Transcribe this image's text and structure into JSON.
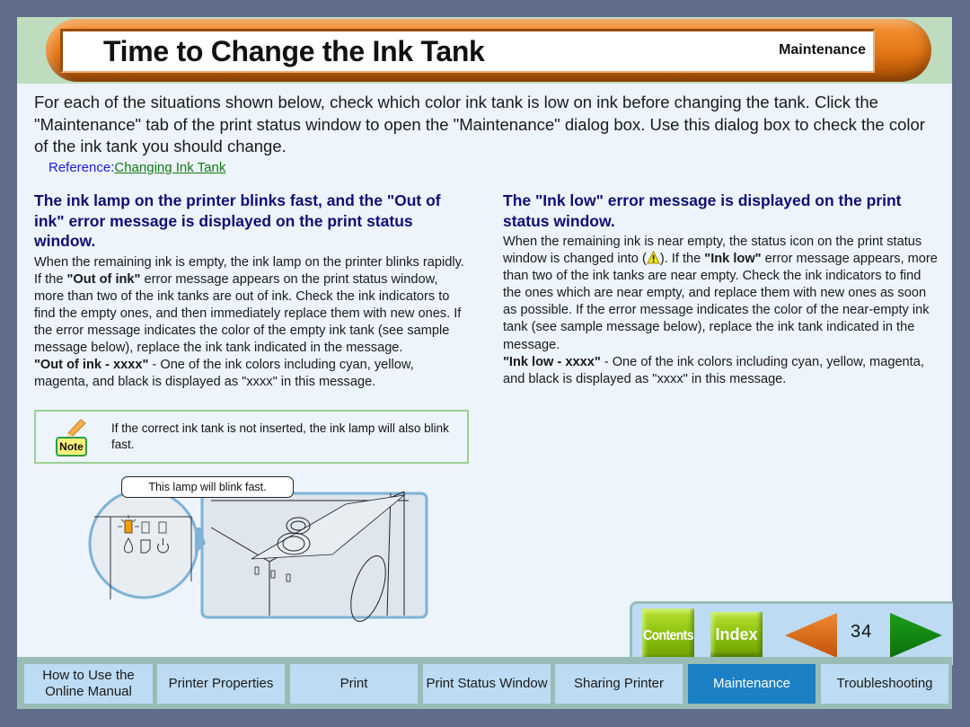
{
  "header": {
    "title": "Time to Change the Ink Tank",
    "section": "Maintenance"
  },
  "intro": {
    "text": "For each of the situations shown below, check which color ink tank is low on ink before changing the tank. Click the \"Maintenance\" tab of the print status window to open the \"Maintenance\" dialog box. Use this dialog box to check the color of the ink tank you should change.",
    "reference_label": "Reference:",
    "reference_link": "Changing Ink Tank"
  },
  "left_section": {
    "heading": "The ink lamp on the printer blinks fast, and the \"Out of ink\" error message is displayed on the print status window.",
    "body_1": "When the remaining ink is empty, the ink lamp on the printer blinks rapidly. If the ",
    "body_bold": "\"Out of ink\"",
    "body_2": " error message appears on the print status window, more than two of the ink tanks are out of ink. Check the ink indicators to find the empty ones, and then immediately replace them with new ones. If the error message indicates the color of the empty ink tank (see sample message below), replace the ink tank indicated in the message.",
    "sample_bold": "\"Out of ink - xxxx\"",
    "sample_text": " - One of the ink colors including cyan, yellow, magenta, and black is displayed as \"xxxx\" in this message."
  },
  "note": {
    "tag": "Note",
    "text": "If the correct ink tank is not inserted, the ink lamp will also blink fast."
  },
  "illustration": {
    "callout": "This lamp will blink fast.",
    "lamp_color": "#f0a000"
  },
  "right_section": {
    "heading": "The \"Ink low\" error message is displayed on the print status window.",
    "body_1": "When the remaining ink is near empty, the status icon on the print status window is changed into (",
    "body_2": "). If the ",
    "body_bold": "\"Ink low\"",
    "body_3": " error message appears, more than two of the ink tanks are near empty. Check the ink indicators to find the ones which are near empty, and replace them with new ones as soon as possible. If the error message indicates the color of the near-empty ink tank (see sample message below), replace the ink tank indicated in the message.",
    "sample_bold": "\"Ink low - xxxx\"",
    "sample_text": " - One of the ink colors including cyan, yellow, magenta, and black is displayed as \"xxxx\" in this message."
  },
  "nav": {
    "contents_label": "Contents",
    "index_label": "Index",
    "page_number": "34",
    "prev_color": "#e06a10",
    "next_color": "#138a13"
  },
  "tabs": [
    {
      "label": "How to Use the Online Manual",
      "active": false
    },
    {
      "label": "Printer Properties",
      "active": false
    },
    {
      "label": "Print",
      "active": false
    },
    {
      "label": "Print Status Window",
      "active": false
    },
    {
      "label": "Sharing Printer",
      "active": false
    },
    {
      "label": "Maintenance",
      "active": true
    },
    {
      "label": "Troubleshooting",
      "active": false
    }
  ]
}
